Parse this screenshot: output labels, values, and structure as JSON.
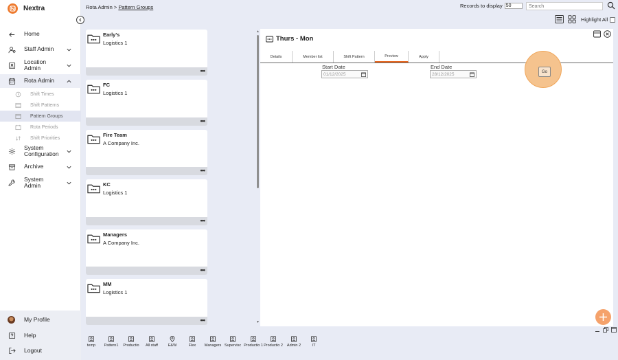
{
  "app": {
    "name": "Nextra"
  },
  "sidebar": {
    "items": [
      {
        "label": "Home",
        "icon": "arrow-left-icon"
      },
      {
        "label": "Staff Admin",
        "icon": "users-icon"
      },
      {
        "label": "Location Admin",
        "icon": "id-card-icon"
      },
      {
        "label": "Rota Admin",
        "icon": "calendar-icon"
      },
      {
        "label": "System Configuration",
        "icon": "gear-icon"
      },
      {
        "label": "Archive",
        "icon": "archive-icon"
      },
      {
        "label": "System Admin",
        "icon": "wrench-icon"
      }
    ],
    "sub_items": [
      {
        "label": "Shift Times"
      },
      {
        "label": "Shift Patterns"
      },
      {
        "label": "Pattern Groups"
      },
      {
        "label": "Rota Periods"
      },
      {
        "label": "Shift Priorities"
      }
    ],
    "bottom": [
      {
        "label": "My Profile",
        "icon": "avatar"
      },
      {
        "label": "Help",
        "icon": "help-icon"
      },
      {
        "label": "Logout",
        "icon": "logout-icon"
      }
    ]
  },
  "breadcrumb": {
    "root": "Rota Admin",
    "sep": ">",
    "current": "Pattern Groups"
  },
  "toolbar": {
    "records_label": "Records to display",
    "records_value": "50",
    "search_placeholder": "Search",
    "highlight_label": "Highlight All"
  },
  "cards": [
    {
      "name": "Early's",
      "company": "Logistics 1"
    },
    {
      "name": "FC",
      "company": "Logistics 1"
    },
    {
      "name": "Fire Team",
      "company": "A Company Inc."
    },
    {
      "name": "KC",
      "company": "Logistics 1"
    },
    {
      "name": "Managers",
      "company": "A Company Inc."
    },
    {
      "name": "MM",
      "company": "Logistics 1"
    }
  ],
  "card_menu": "•••",
  "panel": {
    "title": "Thurs - Mon",
    "tabs": [
      {
        "label": "Details"
      },
      {
        "label": "Member list"
      },
      {
        "label": "Shift Pattern"
      },
      {
        "label": "Preview"
      },
      {
        "label": "Apply"
      }
    ],
    "active_tab": "Preview",
    "start_label": "Start Date",
    "start_value": "01/12/2025",
    "end_label": "End Date",
    "end_value": "28/12/2025",
    "go_label": "Go"
  },
  "tray": [
    {
      "label": "temp"
    },
    {
      "label": "Pattern1"
    },
    {
      "label": "Productio"
    },
    {
      "label": "All staff"
    },
    {
      "label": "E&W"
    },
    {
      "label": "Flex"
    },
    {
      "label": "Managers"
    },
    {
      "label": "Supervisc"
    },
    {
      "label": "Productio 1"
    },
    {
      "label": "Productio 2"
    },
    {
      "label": "Admin 2"
    },
    {
      "label": "IT"
    }
  ],
  "colors": {
    "accent": "#ee7a2e",
    "background": "#e8ebf5",
    "panel": "#ffffff"
  }
}
